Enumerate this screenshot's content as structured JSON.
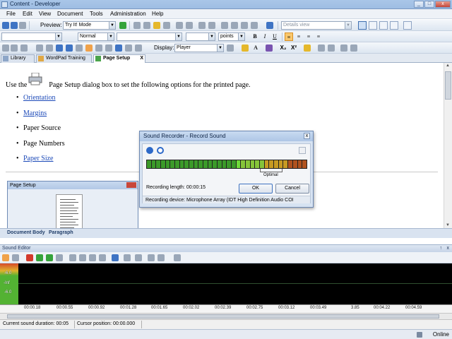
{
  "window": {
    "title": "Content - Developer",
    "min": "_",
    "max": "□",
    "close": "x"
  },
  "menu": [
    "File",
    "Edit",
    "View",
    "Document",
    "Tools",
    "Administration",
    "Help"
  ],
  "toolbar1": {
    "preview_label": "Preview:",
    "preview_mode": "Try It! Mode",
    "view_mode": "Details view"
  },
  "toolbar2": {
    "style": "Normal",
    "font": "",
    "size": "",
    "units": "points",
    "bold": "B",
    "italic": "I",
    "underline": "U"
  },
  "toolbar3": {
    "display_label": "Display:",
    "display_value": "Player",
    "subscript": "X₂",
    "superscript": "X²",
    "font_color": "A"
  },
  "tabs": [
    {
      "label": "Library"
    },
    {
      "label": "WordPad Training"
    },
    {
      "label": "Page Setup",
      "close": "X"
    }
  ],
  "document": {
    "intro_before": "Use the",
    "intro_after": "Page Setup dialog box to set the following options for the printed page.",
    "items": [
      {
        "text": "Orientation",
        "link": true
      },
      {
        "text": "Margins",
        "link": true
      },
      {
        "text": "Paper Source",
        "link": false
      },
      {
        "text": "Page Numbers",
        "link": false
      },
      {
        "text": "Paper Size",
        "link": true
      }
    ],
    "embedded_dialog_title": "Page Setup"
  },
  "doc_status": {
    "left": "Document Body",
    "right": "Paragraph"
  },
  "sound_editor": {
    "title": "Sound Editor",
    "pin": "↑",
    "close": "x",
    "meter_labels": [
      "-6.0",
      "-Inf",
      "-6.0"
    ],
    "ruler_ticks": [
      "00:00.18",
      "00:00.55",
      "00:00.92",
      "00:01.28",
      "00:01.65",
      "00:02.02",
      "00:02.39",
      "00:02.75",
      "00:03.12",
      "00:03.49",
      "3.85",
      "00:04.22",
      "00:04.59"
    ],
    "current_duration": "Current sound duration: 00:05",
    "cursor_position": "Cursor position: 00:00.000"
  },
  "sound_recorder": {
    "title": "Sound Recorder - Record Sound",
    "close": "x",
    "optimal_label": "Optimal",
    "recording_length": "Recording length: 00:00:15",
    "ok": "OK",
    "cancel": "Cancel",
    "device": "Recording device: Microphone Array (IDT High Definition Audio COI"
  },
  "app_status": {
    "online": "Online"
  },
  "colors": {
    "link": "#1b49b8",
    "accent": "#3f74c4",
    "active_format": "#f9c76c"
  }
}
